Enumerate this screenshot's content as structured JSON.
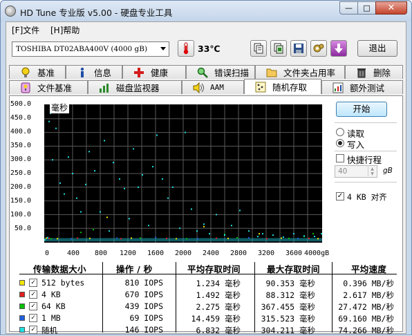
{
  "window": {
    "title": "HD Tune 专业版 v5.00 - 硬盘专业工具",
    "min_label": "—",
    "max_label": "□",
    "close_label": "✕"
  },
  "menu": {
    "file": "[F]文件",
    "help": "[H]帮助"
  },
  "toolbar": {
    "drive": "TOSHIBA DT02ABA400V (4000 gB)",
    "temperature": "33℃",
    "exit": "退出",
    "icons": [
      "thermometer-icon",
      "copy-info-icon",
      "copy-screenshot-icon",
      "save-icon",
      "options-icon",
      "download-icon"
    ]
  },
  "tabs_top": [
    "基准",
    "信息",
    "健康",
    "错误扫描",
    "文件夹占用率",
    "删除"
  ],
  "tabs_bottom": [
    "文件基准",
    "磁盘监视器",
    "AAM",
    "随机存取",
    "额外测试"
  ],
  "active_tab": "随机存取",
  "chart_data": {
    "type": "scatter",
    "unit_label": "毫秒",
    "y_ticks": [
      "500.0",
      "450.0",
      "400.0",
      "350.0",
      "300.0",
      "250.0",
      "200.0",
      "150.0",
      "100.0",
      "50.0"
    ],
    "x_ticks": [
      "0",
      "400",
      "800",
      "1200",
      "1600",
      "2000",
      "2400",
      "2800",
      "3200",
      "3600",
      "4000gB"
    ],
    "xlim": [
      0,
      4000
    ],
    "ylim": [
      0,
      500
    ],
    "grid": true,
    "series": [
      {
        "name": "512 bytes",
        "color": "#f2e600",
        "points": [
          [
            20,
            14
          ],
          [
            180,
            12
          ],
          [
            650,
            13
          ],
          [
            1250,
            14
          ],
          [
            1900,
            12
          ],
          [
            2650,
            13
          ],
          [
            3420,
            14
          ],
          [
            3950,
            12
          ],
          [
            900,
            90
          ],
          [
            2300,
            56
          ],
          [
            3100,
            30
          ]
        ]
      },
      {
        "name": "4 KB",
        "color": "#e02020",
        "points": [
          [
            60,
            13
          ],
          [
            470,
            14
          ],
          [
            1100,
            12
          ],
          [
            1760,
            13
          ],
          [
            2480,
            14
          ],
          [
            3210,
            12
          ],
          [
            3820,
            13
          ]
        ]
      },
      {
        "name": "64 KB",
        "color": "#00c000",
        "points": [
          [
            90,
            12
          ],
          [
            520,
            35
          ],
          [
            1380,
            14
          ],
          [
            2050,
            12
          ],
          [
            2780,
            15
          ],
          [
            3530,
            13
          ],
          [
            3880,
            30
          ],
          [
            700,
            45
          ],
          [
            2600,
            28
          ],
          [
            3750,
            20
          ]
        ]
      },
      {
        "name": "1 MB",
        "color": "#2060e0",
        "points": [
          [
            40,
            15
          ],
          [
            380,
            12
          ],
          [
            1040,
            14
          ],
          [
            1600,
            16
          ],
          [
            2210,
            12
          ],
          [
            2950,
            15
          ],
          [
            3660,
            13
          ]
        ]
      },
      {
        "name": "随机",
        "color": "#20e0e0",
        "points": [
          [
            0,
            8
          ],
          [
            40,
            16
          ],
          [
            60,
            440
          ],
          [
            80,
            470
          ],
          [
            110,
            300
          ],
          [
            160,
            415
          ],
          [
            220,
            215
          ],
          [
            280,
            175
          ],
          [
            340,
            310
          ],
          [
            400,
            250
          ],
          [
            460,
            160
          ],
          [
            520,
            110
          ],
          [
            590,
            210
          ],
          [
            640,
            330
          ],
          [
            720,
            260
          ],
          [
            800,
            110
          ],
          [
            860,
            370
          ],
          [
            930,
            40
          ],
          [
            990,
            290
          ],
          [
            1080,
            230
          ],
          [
            1150,
            195
          ],
          [
            1220,
            85
          ],
          [
            1280,
            340
          ],
          [
            1350,
            200
          ],
          [
            1410,
            245
          ],
          [
            1500,
            60
          ],
          [
            1560,
            275
          ],
          [
            1620,
            390
          ],
          [
            1700,
            230
          ],
          [
            1780,
            160
          ],
          [
            1850,
            200
          ],
          [
            1950,
            50
          ],
          [
            2030,
            400
          ],
          [
            2120,
            120
          ],
          [
            2200,
            40
          ],
          [
            2300,
            65
          ],
          [
            2380,
            30
          ],
          [
            2480,
            100
          ],
          [
            2600,
            25
          ],
          [
            2700,
            60
          ],
          [
            2820,
            115
          ],
          [
            2950,
            40
          ],
          [
            3080,
            20
          ],
          [
            3150,
            30
          ],
          [
            3300,
            25
          ],
          [
            3450,
            18
          ],
          [
            3600,
            30
          ],
          [
            3750,
            22
          ],
          [
            3900,
            20
          ],
          [
            4000,
            30
          ]
        ]
      }
    ]
  },
  "controls": {
    "start": "开始",
    "read": "读取",
    "write": "写入",
    "short_stroke": "快捷行程",
    "gb_value": "40",
    "gb_unit": "gB",
    "align_4kb": "4 KB 对齐"
  },
  "results": {
    "headers": [
      "传输数据大小",
      "操作 / 秒",
      "平均存取时间",
      "最大存取时间",
      "平均速度"
    ],
    "rows": [
      {
        "color": "#f2e600",
        "name": "512 bytes",
        "ops": "810 IOPS",
        "avg": "1.234 毫秒",
        "max": "90.353 毫秒",
        "speed": "0.396 MB/秒"
      },
      {
        "color": "#e02020",
        "name": "4 KB",
        "ops": "670 IOPS",
        "avg": "1.492 毫秒",
        "max": "88.312 毫秒",
        "speed": "2.617 MB/秒"
      },
      {
        "color": "#00c000",
        "name": "64 KB",
        "ops": "439 IOPS",
        "avg": "2.275 毫秒",
        "max": "367.455 毫秒",
        "speed": "27.472 MB/秒"
      },
      {
        "color": "#2060e0",
        "name": "1 MB",
        "ops": "69 IOPS",
        "avg": "14.459 毫秒",
        "max": "315.523 毫秒",
        "speed": "69.160 MB/秒"
      },
      {
        "color": "#20e0e0",
        "name": "随机",
        "ops": "146 IOPS",
        "avg": "6.832 毫秒",
        "max": "304.211 毫秒",
        "speed": "74.266 MB/秒"
      }
    ]
  }
}
